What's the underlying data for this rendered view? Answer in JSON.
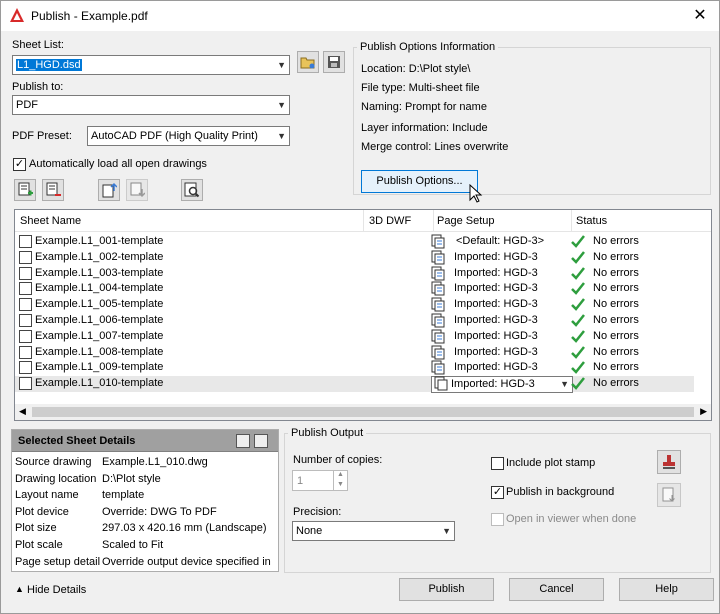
{
  "window": {
    "title": "Publish - Example.pdf",
    "close_glyph": "✕"
  },
  "sheet_list": {
    "label": "Sheet List:",
    "value": "L1_HGD.dsd"
  },
  "publish_to": {
    "label": "Publish to:",
    "value": "PDF"
  },
  "pdf_preset": {
    "label": "PDF Preset:",
    "value": "AutoCAD PDF (High Quality Print)"
  },
  "auto_load": {
    "label": "Automatically load all open drawings",
    "checked": true
  },
  "options_info": {
    "title": "Publish Options Information",
    "location": "Location: D:\\Plot style\\",
    "file_type": "File type: Multi-sheet file",
    "naming": "Naming: Prompt for name",
    "layer_info": "Layer information: Include",
    "merge_control": "Merge control: Lines overwrite",
    "button": "Publish Options..."
  },
  "table": {
    "headers": [
      "Sheet Name",
      "3D DWF",
      "Page Setup",
      "Status"
    ],
    "rows": [
      {
        "name": "Example.L1_001-template",
        "setup": "<Default: HGD-3>",
        "status": "No errors"
      },
      {
        "name": "Example.L1_002-template",
        "setup": "Imported: HGD-3",
        "status": "No errors"
      },
      {
        "name": "Example.L1_003-template",
        "setup": "Imported: HGD-3",
        "status": "No errors"
      },
      {
        "name": "Example.L1_004-template",
        "setup": "Imported: HGD-3",
        "status": "No errors"
      },
      {
        "name": "Example.L1_005-template",
        "setup": "Imported: HGD-3",
        "status": "No errors"
      },
      {
        "name": "Example.L1_006-template",
        "setup": "Imported: HGD-3",
        "status": "No errors"
      },
      {
        "name": "Example.L1_007-template",
        "setup": "Imported: HGD-3",
        "status": "No errors"
      },
      {
        "name": "Example.L1_008-template",
        "setup": "Imported: HGD-3",
        "status": "No errors"
      },
      {
        "name": "Example.L1_009-template",
        "setup": "Imported: HGD-3",
        "status": "No errors"
      },
      {
        "name": "Example.L1_010-template",
        "setup": "Imported: HGD-3",
        "status": "No errors"
      }
    ]
  },
  "details": {
    "title": "Selected Sheet Details",
    "items": [
      {
        "key": "Source drawing",
        "value": "Example.L1_010.dwg"
      },
      {
        "key": "Drawing location",
        "value": "D:\\Plot style"
      },
      {
        "key": "Layout name",
        "value": "template"
      },
      {
        "key": "Plot device",
        "value": "Override: DWG To PDF"
      },
      {
        "key": "Plot size",
        "value": "297.03 x 420.16 mm (Landscape)"
      },
      {
        "key": "Plot scale",
        "value": "Scaled to Fit"
      },
      {
        "key": "Page setup detail",
        "value": "Override output device specified in ..."
      }
    ]
  },
  "output": {
    "title": "Publish Output",
    "copies_label": "Number of copies:",
    "copies_value": "1",
    "precision_label": "Precision:",
    "precision_value": "None",
    "include_stamp": "Include plot stamp",
    "publish_bg": "Publish in background",
    "open_viewer": "Open in viewer when done"
  },
  "footer": {
    "hide_details": "Hide Details",
    "publish": "Publish",
    "cancel": "Cancel",
    "help": "Help"
  },
  "colors": {
    "accent": "#0078d7",
    "check": "#2e9e3e",
    "logo": "#d82a2a"
  }
}
